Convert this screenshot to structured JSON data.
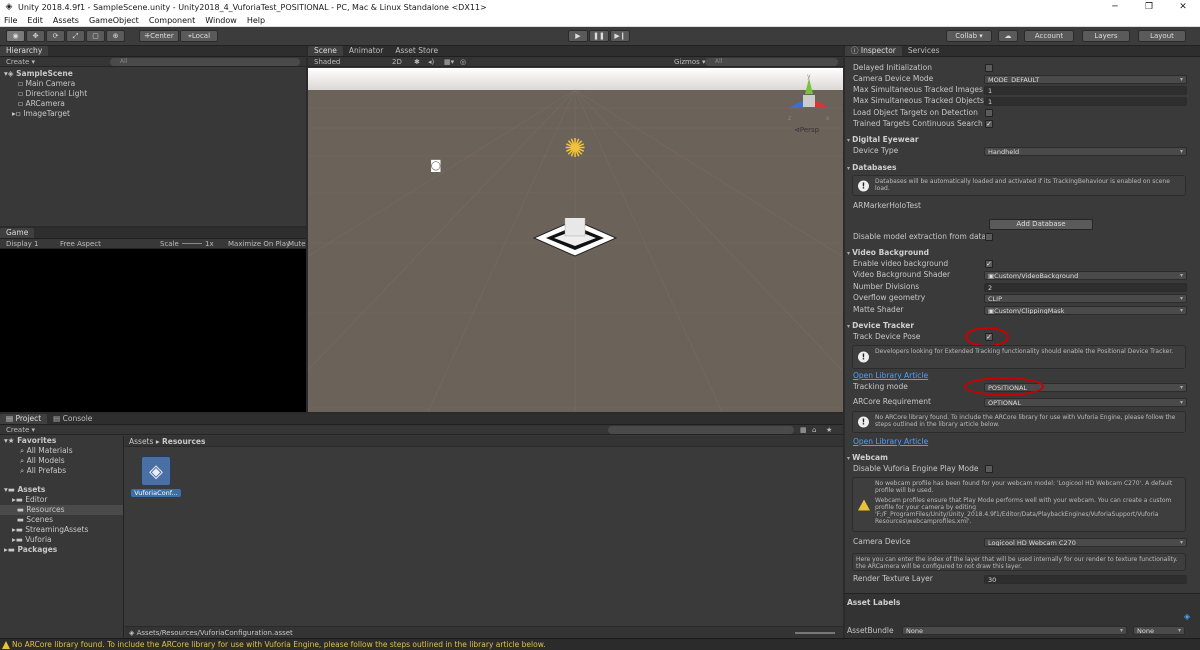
{
  "window": {
    "title": "Unity 2018.4.9f1 - SampleScene.unity - Unity2018_4_VuforiaTest_POSITIONAL - PC, Mac & Linux Standalone <DX11>",
    "minimize": "─",
    "maximize": "❐",
    "close": "✕"
  },
  "menu": [
    "File",
    "Edit",
    "Assets",
    "GameObject",
    "Component",
    "Window",
    "Help"
  ],
  "toolbar": {
    "pivot": "Center",
    "space": "Local",
    "collab": "Collab ▾",
    "account": "Account",
    "layers": "Layers",
    "layout": "Layout"
  },
  "hierarchy": {
    "tab": "Hierarchy",
    "create": "Create ▾",
    "search_placeholder": "All",
    "scene": "SampleScene",
    "items": [
      "Main Camera",
      "Directional Light",
      "ARCamera",
      "ImageTarget"
    ]
  },
  "scene_view": {
    "tabs": [
      "Scene",
      "Animator",
      "Asset Store"
    ],
    "shading": "Shaded",
    "mode2d": "2D",
    "gizmos": "Gizmos ▾",
    "search_placeholder": "All",
    "persp": "Persp",
    "axis_x": "x",
    "axis_y": "y",
    "axis_z": "z"
  },
  "game_view": {
    "tab": "Game",
    "display": "Display 1",
    "aspect": "Free Aspect",
    "scale_label": "Scale",
    "scale_value": "1x",
    "max_on_play": "Maximize On Play",
    "mute": "Mute"
  },
  "project": {
    "tabs": [
      "Project",
      "Console"
    ],
    "create": "Create ▾",
    "favorites": "Favorites",
    "fav_items": [
      "All Materials",
      "All Models",
      "All Prefabs"
    ],
    "assets": "Assets",
    "asset_items": [
      "Editor",
      "Resources",
      "Scenes",
      "StreamingAssets",
      "Vuforia"
    ],
    "packages": "Packages",
    "breadcrumb_root": "Assets",
    "breadcrumb_sep": "▸",
    "breadcrumb_current": "Resources",
    "file_name": "VuforiaConf...",
    "footer_path": "Assets/Resources/VuforiaConfiguration.asset"
  },
  "inspector": {
    "tabs": [
      "Inspector",
      "Services"
    ],
    "delayed_init": "Delayed Initialization",
    "camera_device_mode": "Camera Device Mode",
    "camera_device_mode_val": "MODE_DEFAULT",
    "max_images": "Max Simultaneous Tracked Images",
    "max_images_val": "1",
    "max_objects": "Max Simultaneous Tracked Objects",
    "max_objects_val": "1",
    "load_object": "Load Object Targets on Detection",
    "trained_targets": "Trained Targets Continuous Search",
    "digital_eyewear": "Digital Eyewear",
    "device_type": "Device Type",
    "device_type_val": "Handheld",
    "databases": "Databases",
    "db_help": "Databases will be automatically loaded and activated if its TrackingBehaviour is enabled on scene load.",
    "db_name": "ARMarkerHoloTest",
    "add_database": "Add Database",
    "disable_extraction": "Disable model extraction from datab",
    "video_bg": "Video Background",
    "enable_video_bg": "Enable video background",
    "video_bg_shader": "Video Background Shader",
    "video_bg_shader_val": "Custom/VideoBackground",
    "num_divisions": "Number Divisions",
    "num_divisions_val": "2",
    "overflow_geom": "Overflow geometry",
    "overflow_geom_val": "CLIP",
    "matte_shader": "Matte Shader",
    "matte_shader_val": "Custom/ClippingMask",
    "device_tracker": "Device Tracker",
    "track_device_pose": "Track Device Pose",
    "tracker_help": "Developers looking for Extended Tracking functionality should enable the Positional Device Tracker.",
    "open_library_article": "Open Library Article",
    "tracking_mode": "Tracking mode",
    "tracking_mode_val": "POSITIONAL",
    "arcore_req": "ARCore Requirement",
    "arcore_req_val": "OPTIONAL",
    "arcore_help": "No ARCore library found. To include the ARCore library for use with Vuforia Engine, please follow the steps outlined in the library article below.",
    "open_library_article2": "Open Library Article",
    "webcam": "Webcam",
    "disable_play_mode": "Disable Vuforia Engine Play Mode",
    "webcam_help1": "No webcam profile has been found for your webcam model: 'Logicool HD Webcam C270'. A default profile will be used.",
    "webcam_help2": "Webcam profiles ensure that Play Mode performs well with your webcam. You can create a custom profile for your camera by editing 'F:/F_ProgramFiles/Unity/Unity_2018.4.9f1/Editor/Data/PlaybackEngines/VuforiaSupport/Vuforia Resources\\webcamprofiles.xml'.",
    "camera_device": "Camera Device",
    "camera_device_val": "Logicool HD Webcam C270",
    "layer_help": "Here you can enter the index of the layer that will be used internally for our render to texture functionality. the ARCamera will be configured to not draw this layer.",
    "render_layer": "Render Texture Layer",
    "render_layer_val": "30",
    "asset_labels": "Asset Labels",
    "asset_bundle": "AssetBundle",
    "asset_bundle_val": "None",
    "asset_variant_val": "None"
  },
  "status": {
    "message": "No ARCore library found. To include the ARCore library for use with Vuforia Engine, please follow the steps outlined in the library article below."
  },
  "colors": {
    "scene_sky_top": "#ffffff",
    "scene_ground": "#6b6259",
    "annotation_red": "#cc0000",
    "link_blue": "#4aa3ff"
  }
}
